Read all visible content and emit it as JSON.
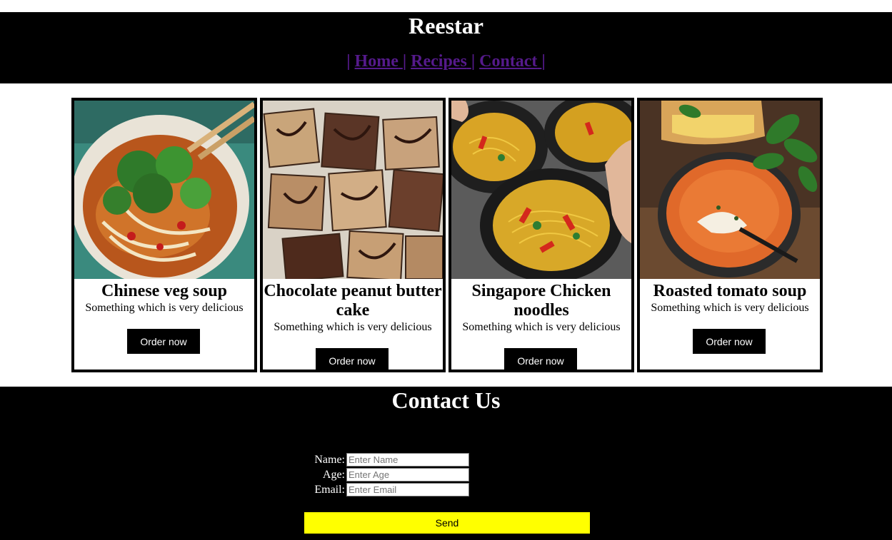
{
  "header": {
    "title": "Reestar",
    "nav": {
      "open": "|",
      "home": "Home",
      "sep1": "|",
      "recipes": "Recipes",
      "sep2": "|",
      "contact": "Contact",
      "close": "|"
    }
  },
  "cards": [
    {
      "title": "Chinese veg soup",
      "description": "Something which is very delicious",
      "button": "Order now",
      "image": "noodle-soup-bowl"
    },
    {
      "title": "Chocolate peanut butter cake",
      "description": "Something which is very delicious",
      "button": "Order now",
      "image": "chocolate-peanut-butter-brownies"
    },
    {
      "title": "Singapore Chicken noodles",
      "description": "Something which is very delicious",
      "button": "Order now",
      "image": "singapore-noodle-bowls"
    },
    {
      "title": "Roasted tomato soup",
      "description": "Something which is very delicious",
      "button": "Order now",
      "image": "tomato-soup-bowl"
    }
  ],
  "contact": {
    "title": "Contact Us",
    "fields": [
      {
        "label": "Name:",
        "placeholder": "Enter Name"
      },
      {
        "label": "Age:",
        "placeholder": "Enter Age"
      },
      {
        "label": "Email:",
        "placeholder": "Enter Email"
      }
    ],
    "send": "Send"
  },
  "colors": {
    "header_bg": "#000000",
    "nav_link": "#551a8b",
    "button_bg": "#000000",
    "send_bg": "#ffff00"
  }
}
